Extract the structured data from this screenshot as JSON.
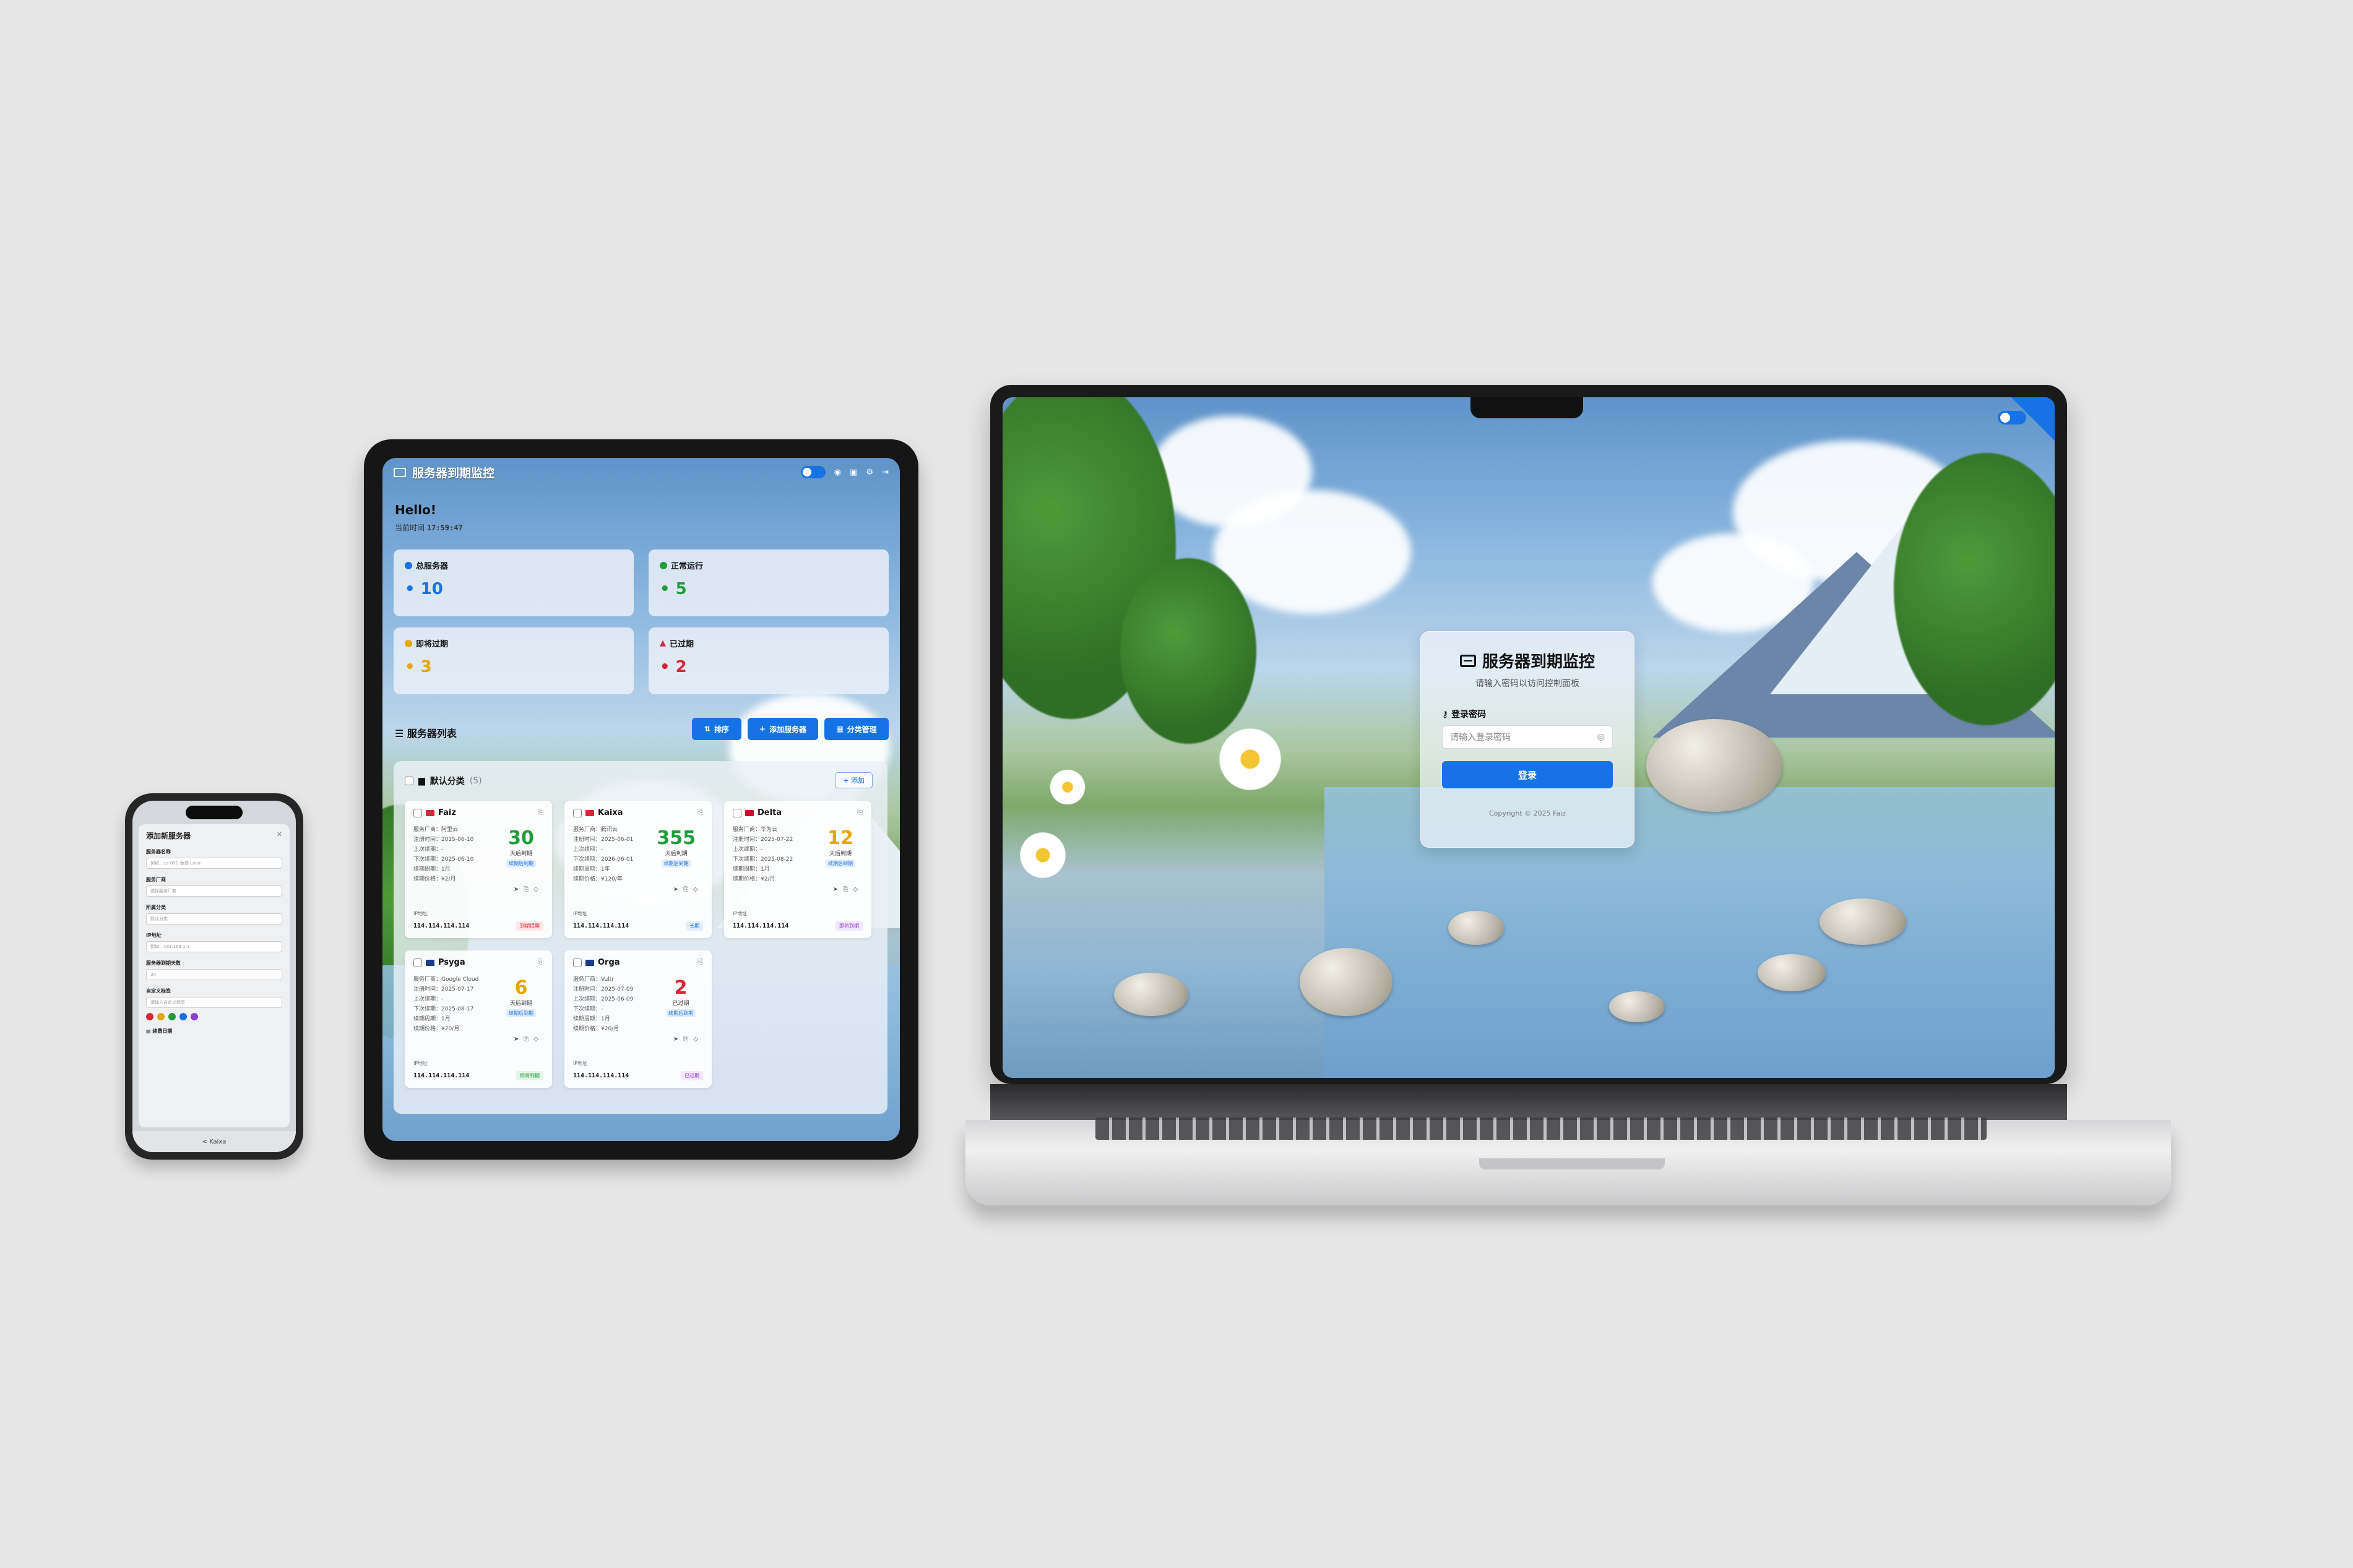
{
  "app": {
    "title": "服务器到期监控"
  },
  "laptop": {
    "login": {
      "title": "服务器到期监控",
      "subtitle": "请输入密码以访问控制面板",
      "password_label": "登录密码",
      "password_placeholder": "请输入登录密码",
      "submit_label": "登录",
      "copyright": "Copyright © 2025 Faiz"
    }
  },
  "tablet": {
    "greeting": "Hello!",
    "time_label": "当前时间",
    "time_value": "17:59:47",
    "stats": [
      {
        "label": "总服务器",
        "value": "10",
        "color": "#1673e6"
      },
      {
        "label": "正常运行",
        "value": "5",
        "color": "#1f9d3a"
      },
      {
        "label": "即将过期",
        "value": "3",
        "color": "#e6a700"
      },
      {
        "label": "已过期",
        "value": "2",
        "color": "#d6283a"
      }
    ],
    "list_title": "服务器列表",
    "buttons": {
      "sort": "排序",
      "add_server": "添加服务器",
      "category_manage": "分类管理"
    },
    "group": {
      "name": "默认分类",
      "count": "(5)",
      "add": "+ 添加"
    },
    "ip_label": "IP地址",
    "servers": [
      {
        "name": "Faiz",
        "flag_color": "#d6283a",
        "days": "30",
        "days_color": "#1f9d3a",
        "unit": "天后到期",
        "tag": "续期后到期",
        "rows": [
          "服务厂商：阿里云",
          "注册时间：2025-06-10",
          "上次续期：-",
          "下次续期：2025-06-10",
          "续期周期：1月",
          "续期价格：¥2/月"
        ],
        "ip": "114.114.114.114",
        "badge": "到期提醒",
        "badge_color": "#d6283a",
        "badge_bg": "#fde6e8"
      },
      {
        "name": "Kaixa",
        "flag_color": "#d6283a",
        "days": "355",
        "days_color": "#1f9d3a",
        "unit": "天后到期",
        "tag": "续期后到期",
        "rows": [
          "服务厂商：腾讯云",
          "注册时间：2025-06-01",
          "上次续期：-",
          "下次续期：2026-06-01",
          "续期周期：1年",
          "续期价格：¥120/年"
        ],
        "ip": "114.114.114.114",
        "badge": "长期",
        "badge_color": "#1673e6",
        "badge_bg": "#e3eefc"
      },
      {
        "name": "Delta",
        "flag_color": "#c8102e",
        "days": "12",
        "days_color": "#e6a700",
        "unit": "天后到期",
        "tag": "续期后到期",
        "rows": [
          "服务厂商：华为云",
          "注册时间：2025-07-22",
          "上次续期：-",
          "下次续期：2025-08-22",
          "续期周期：1月",
          "续期价格：¥2/月"
        ],
        "ip": "114.114.114.114",
        "badge": "即将到期",
        "badge_color": "#8b3fd1",
        "badge_bg": "#f1e6fb"
      },
      {
        "name": "Psyga",
        "flag_color": "#1a3c8c",
        "days": "6",
        "days_color": "#e6a700",
        "unit": "天后到期",
        "tag": "续期后到期",
        "rows": [
          "服务厂商：Google Cloud",
          "注册时间：2025-07-17",
          "上次续期：-",
          "下次续期：2025-08-17",
          "续期周期：1月",
          "续期价格：¥20/月"
        ],
        "ip": "114.114.114.114",
        "badge": "即将到期",
        "badge_color": "#1f9d3a",
        "badge_bg": "#e2f5e6"
      },
      {
        "name": "Orga",
        "flag_color": "#1a3c8c",
        "days": "2",
        "days_color": "#d6283a",
        "unit": "已过期",
        "tag": "续期后到期",
        "rows": [
          "服务厂商：Vultr",
          "注册时间：2025-07-09",
          "上次续期：2025-06-09",
          "下次续期：-",
          "续期周期：1月",
          "续期价格：¥20/月"
        ],
        "ip": "114.114.114.114",
        "badge": "已过期",
        "badge_color": "#8b3fd1",
        "badge_bg": "#f1e6fb"
      }
    ]
  },
  "phone": {
    "dialog_title": "添加新服务器",
    "fields": [
      {
        "label": "服务器名称",
        "placeholder": "例如：Lo-001-香港-Lana"
      },
      {
        "label": "服务厂商",
        "placeholder": "选择服务厂商"
      },
      {
        "label": "所属分类",
        "placeholder": "默认分类"
      },
      {
        "label": "IP地址",
        "placeholder": "例如：192.168.1.1"
      },
      {
        "label": "服务器到期天数",
        "placeholder": "30"
      },
      {
        "label": "自定义标签",
        "placeholder": "请输入自定义标签"
      }
    ],
    "colors": [
      "#d6283a",
      "#e6a700",
      "#1f9d3a",
      "#1673e6",
      "#8b3fd1"
    ],
    "footer_label": "续费日期",
    "bottom_bar": "< Kaixa"
  }
}
